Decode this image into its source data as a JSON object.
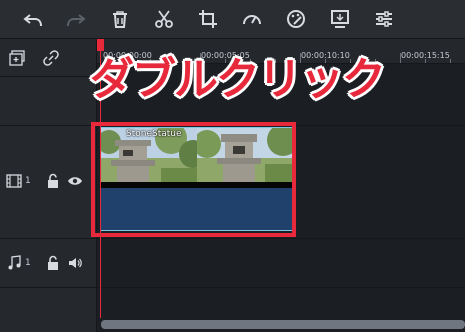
{
  "toolbar": {
    "buttons": [
      "undo-icon",
      "redo-icon",
      "delete-icon",
      "cut-icon",
      "crop-icon",
      "speed-icon",
      "color-icon",
      "export-frame-icon",
      "audio-mixer-icon"
    ]
  },
  "ruler": {
    "ticks": [
      "00:00:00:00",
      "00:00:05:05",
      "00:00:10:10",
      "00:00:15:15"
    ]
  },
  "tracks": {
    "video": {
      "number": "1"
    },
    "audio": {
      "number": "1"
    }
  },
  "clip": {
    "title": "StoneStatue"
  },
  "annotation": {
    "text": "ダブルクリック"
  },
  "colors": {
    "highlight": "#e8293b",
    "clip": "#1f416c",
    "clip_border": "#7ec8e3"
  }
}
